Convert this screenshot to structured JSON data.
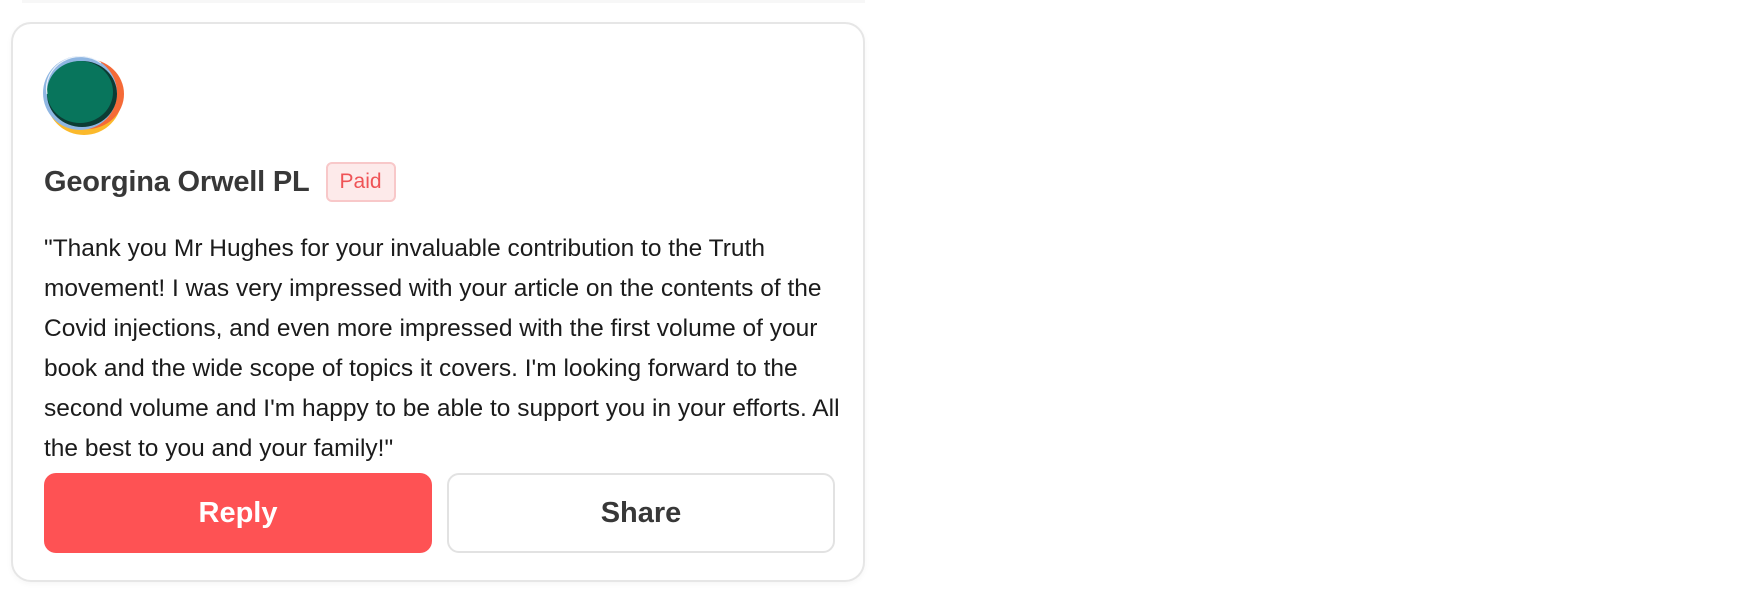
{
  "comment_card": {
    "author": {
      "name": "Georgina Orwell PL",
      "badge": "Paid",
      "avatar_icon": "circle-avatar-icon"
    },
    "text": "\"Thank you Mr Hughes for your invaluable contribution to the Truth movement! I was very impressed with your article on the contents of the Covid injections, and even more impressed with the first volume of your book and the wide scope of topics it covers. I'm looking forward to the second volume and I'm happy to be able to support you in your efforts. All the best to you and your family!\"",
    "actions": {
      "reply_label": "Reply",
      "share_label": "Share"
    }
  },
  "colors": {
    "accent": "#fe5254",
    "badge_text": "#ef5356",
    "badge_bg": "#fdeaea",
    "avatar_green": "#08755c",
    "avatar_orange": "#f56a37",
    "avatar_yellow": "#fbb92b",
    "avatar_blue": "#8fb6e2"
  }
}
